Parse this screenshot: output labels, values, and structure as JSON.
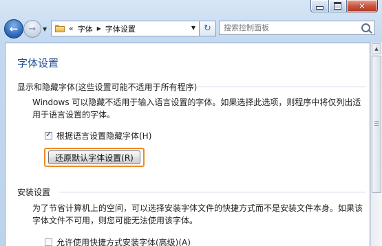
{
  "window": {
    "caption": {
      "minimize_icon": "minimize-icon",
      "maximize_icon": "maximize-icon",
      "close_icon": "close-icon",
      "close_glyph": "✕"
    }
  },
  "nav": {
    "back_glyph": "←",
    "forward_glyph": "→",
    "history_dropdown_glyph": "▼",
    "address": {
      "overflow": "«",
      "path": [
        "字体",
        "字体设置"
      ],
      "separator": "▶",
      "dropdown_glyph": "▼"
    },
    "refresh_glyph": "↻",
    "search_placeholder": "搜索控制面板"
  },
  "page": {
    "title": "字体设置",
    "hide_section": {
      "heading": "显示和隐藏字体(这些设置可能不适用于所有程序)",
      "description": "Windows 可以隐藏不适用于输入语言设置的字体。如果选择此选项，则程序中将仅列出适用于语言设置的字体。",
      "checkbox_label": "根据语言设置隐藏字体(H)",
      "checkbox_checked": true,
      "restore_button": "还原默认字体设置(R)",
      "restore_highlight_color": "#ef8a25"
    },
    "install_section": {
      "heading": "安装设置",
      "description": "为了节省计算机上的空间，可以选择安装字体文件的快捷方式而不是安装文件本身。如果该字体文件不可用，则您可能无法使用该字体。",
      "checkbox_label": "允许使用快捷方式安装字体(高级)(A)",
      "checkbox_checked": false
    }
  },
  "colors": {
    "title_blue": "#1f4e8f",
    "frame_blue": "#c3d9f1"
  }
}
